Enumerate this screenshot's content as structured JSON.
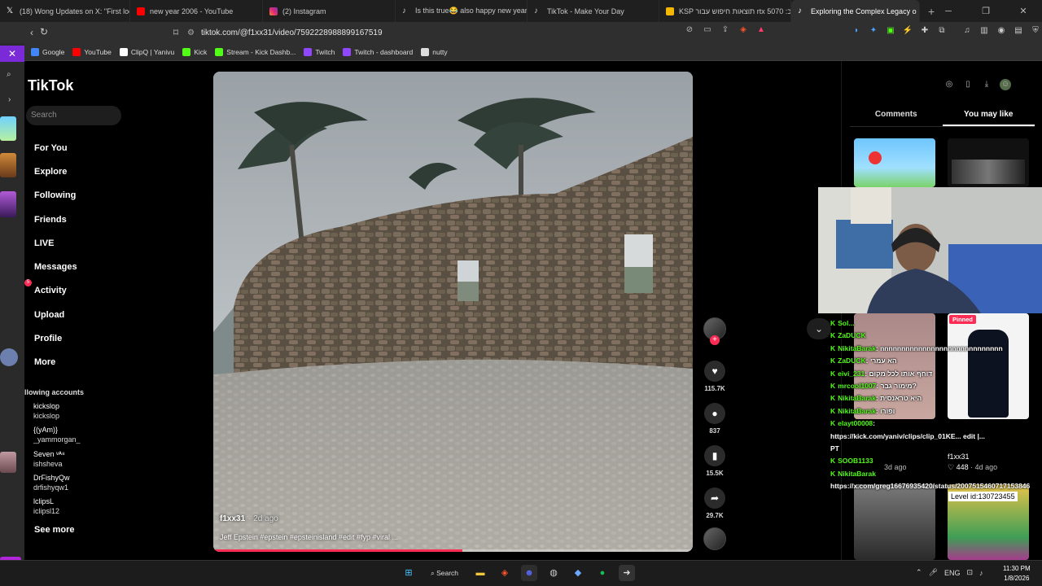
{
  "browser": {
    "tabs": [
      {
        "title": "(18) Wong Updates on X: \"First look",
        "icon": "x-logo-icon",
        "color": "#ffffff"
      },
      {
        "title": "new year 2006 - YouTube",
        "icon": "youtube-icon",
        "color": "#ff0000"
      },
      {
        "title": "(2) Instagram",
        "icon": "instagram-icon",
        "color": "#e1306c"
      },
      {
        "title": "Is this true😂 also happy new years",
        "icon": "tiktok-icon",
        "color": "#ffffff"
      },
      {
        "title": "TikTok - Make Your Day",
        "icon": "tiktok-icon",
        "color": "#ffffff"
      },
      {
        "title": "KSP תוצאות חיפוש עבור rtx 5070 :כ",
        "icon": "ksp-icon",
        "color": "#f5b700"
      },
      {
        "title": "Exploring the Complex Legacy o",
        "icon": "tiktok-icon",
        "color": "#ffffff",
        "active": true
      }
    ],
    "new_tab": "+",
    "url": "tiktok.com/@f1xx31/video/7592228988899167519",
    "bookmarks": [
      {
        "label": "Google",
        "color": "#4285f4"
      },
      {
        "label": "YouTube",
        "color": "#ff0000"
      },
      {
        "label": "ClipQ | Yanivu",
        "color": "#ffffff"
      },
      {
        "label": "Kick",
        "color": "#53fc18"
      },
      {
        "label": "Stream - Kick Dashb...",
        "color": "#53fc18"
      },
      {
        "label": "Twitch",
        "color": "#9146ff"
      },
      {
        "label": "Twitch - dashboard",
        "color": "#9146ff"
      },
      {
        "label": "nutty",
        "color": "#dddddd"
      }
    ]
  },
  "tiktok": {
    "logo": "TikTok",
    "search_placeholder": "Search",
    "nav": [
      "For You",
      "Explore",
      "Following",
      "Friends",
      "LIVE",
      "Messages",
      "Activity",
      "Upload",
      "Profile",
      "More"
    ],
    "activity_badge": "5",
    "following_header": "llowing accounts",
    "accounts": [
      {
        "name": "kickslop",
        "user": "kickslop"
      },
      {
        "name": "{(yAm)}",
        "user": "_yammorgan_"
      },
      {
        "name": "Seven ᵛᴬ⁸",
        "user": "ishsheva"
      },
      {
        "name": "DrFishyQw",
        "user": "drfishyqw1"
      },
      {
        "name": "lclipsL",
        "user": "iclipsl12"
      }
    ],
    "see_more": "See more"
  },
  "video": {
    "author": "f1xx31",
    "age": "· 2d ago",
    "caption": "Jeff Epstein #epstein #epsteinisland #edit #fyp #viral ...",
    "progress_fraction": 0.52,
    "likes": "115.7K",
    "comments": "837",
    "saves": "15.5K",
    "shares": "29.7K"
  },
  "right_panel": {
    "tabs": [
      "Comments",
      "You may like"
    ],
    "pinned": "Pinned",
    "level_id": "Level id:130723455",
    "meta_author": "f1xx31",
    "meta_likes": "♡ 448",
    "meta_age": "· 4d ago",
    "meta_age2": "3d ago"
  },
  "chat": [
    {
      "user": "Sol...",
      "msg": ""
    },
    {
      "user": "ZaDUCK",
      "msg": ""
    },
    {
      "user": "NikitaBarak",
      "msg": ": nnnnnnnnnnnnnnnnnnnnnnnnnnnnn"
    },
    {
      "user": "ZaDUCK",
      "msg": ": הא עמרי"
    },
    {
      "user": "eivi_231",
      "msg": ": דוחף אותו לכל מקום"
    },
    {
      "user": "mrcool1007",
      "msg": ": מימור גבר?"
    },
    {
      "user": "NikitaBarak",
      "msg": ": היא טראנסית"
    },
    {
      "user": "NikitaBarak",
      "msg": ": ופורו"
    },
    {
      "user": "elayt00008",
      "msg": ":"
    },
    {
      "user": "",
      "msg": "https://kick.com/yaniv/clips/clip_01KE... edit |..."
    },
    {
      "user": "",
      "msg": "PT"
    },
    {
      "user": "SOOB1133",
      "msg": ""
    },
    {
      "user": "NikitaBarak",
      "msg": ""
    },
    {
      "user": "",
      "msg": "https://x.com/greg16676935420/status/2007515460717153846"
    }
  ],
  "taskbar": {
    "search_label": "Search",
    "lang": "ENG",
    "time": "11:30 PM",
    "date": "1/8/2026"
  },
  "colors": {
    "tiktok_red": "#fe2c55",
    "kick_green": "#53fc18"
  }
}
